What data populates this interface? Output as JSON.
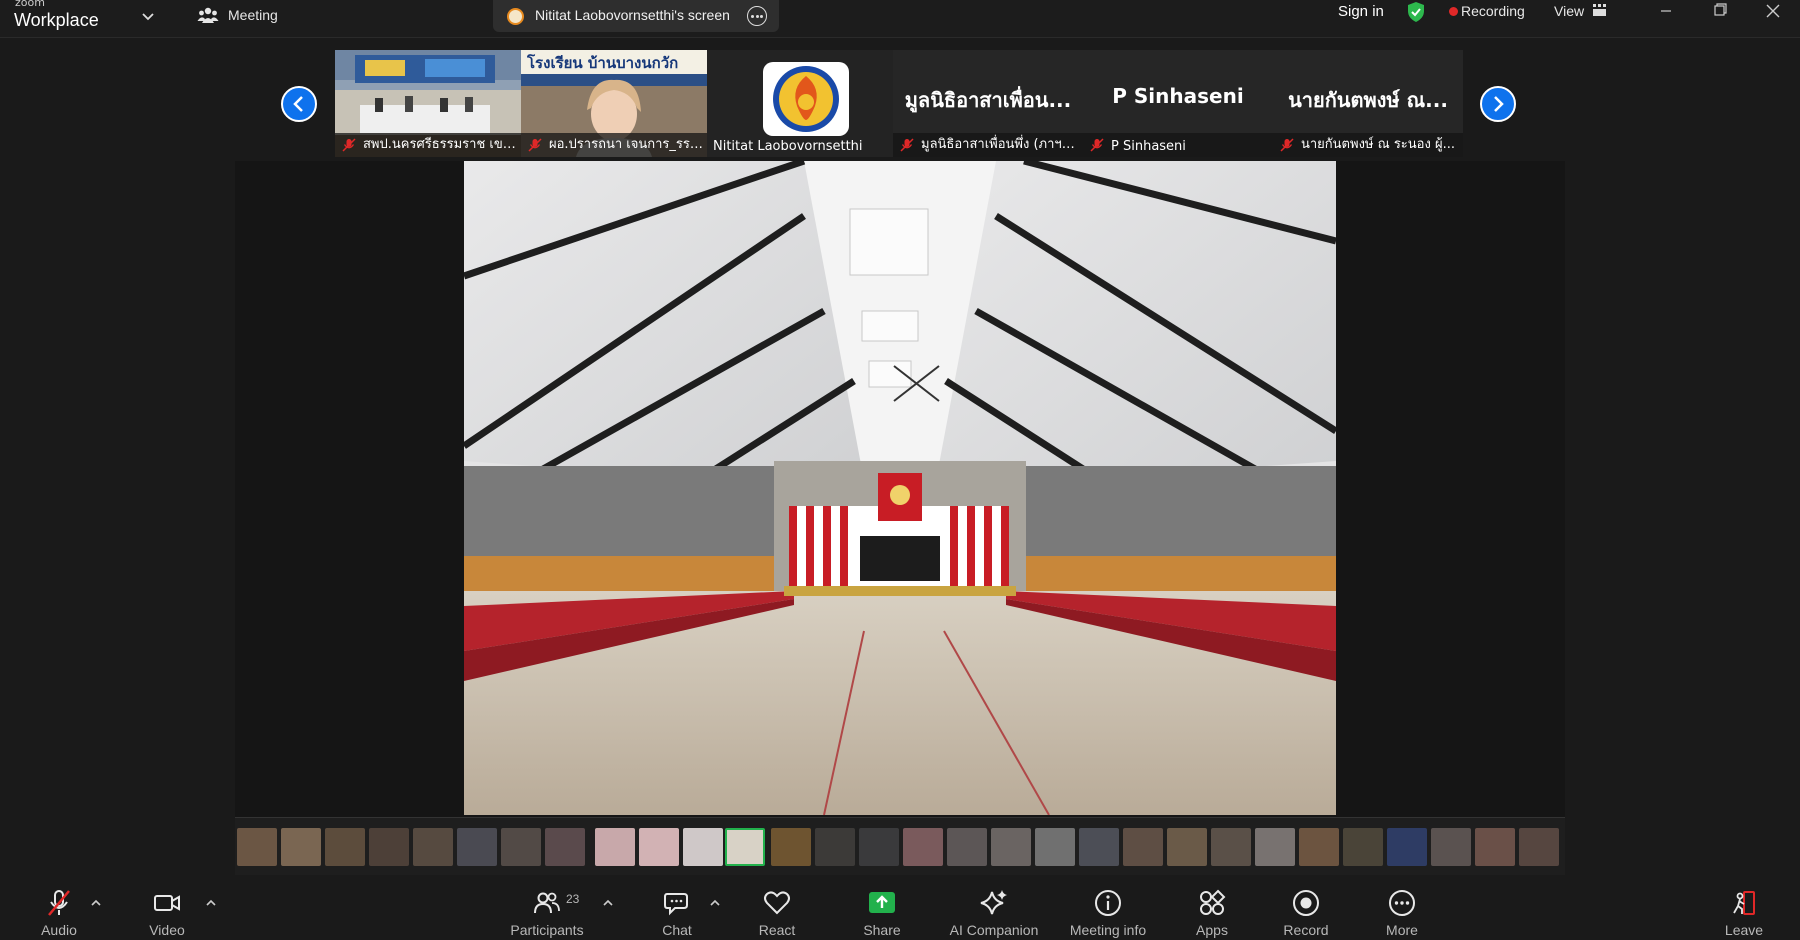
{
  "app": {
    "brand_top": "zoom",
    "brand": "Workplace",
    "meeting_label": "Meeting"
  },
  "screen_tab": {
    "label": "Nititat Laobovornsetthi's screen"
  },
  "header_right": {
    "sign_in": "Sign in",
    "recording": "Recording",
    "view": "View"
  },
  "participants_strip": [
    {
      "name": "สพป.นครศรีธรรมราช เขต...",
      "muted": true,
      "kind": "video"
    },
    {
      "name": "ผอ.ปรารถนา เจนการ_รร.บ้...",
      "muted": true,
      "kind": "video",
      "banner": "โรงเรียน บ้านบางนกวัก"
    },
    {
      "name": "Nititat Laobovornsetthi",
      "muted": false,
      "kind": "logo"
    },
    {
      "name": "มูลนิธิอาสาเพื่อนพึ่ง (ภาฯ)...",
      "display": "มูลนิธิอาสาเพื่อน...",
      "muted": true,
      "kind": "name"
    },
    {
      "name": "P Sinhaseni",
      "display": "P Sinhaseni",
      "muted": true,
      "kind": "name"
    },
    {
      "name": "นายกันตพงษ์ ณ ระนอง ผู้...",
      "display": "นายกันตพงษ์ ณ...",
      "muted": true,
      "kind": "name"
    }
  ],
  "toolbar": {
    "audio": "Audio",
    "video": "Video",
    "participants": "Participants",
    "participants_count": "23",
    "chat": "Chat",
    "react": "React",
    "share": "Share",
    "ai_companion": "AI Companion",
    "meeting_info": "Meeting info",
    "apps": "Apps",
    "record": "Record",
    "more": "More",
    "leave": "Leave"
  },
  "colors": {
    "accent": "#0e72ed",
    "share_green": "#22b14c",
    "recording_red": "#e02828",
    "mute_red": "#e02828",
    "shield_green": "#2db84d"
  }
}
